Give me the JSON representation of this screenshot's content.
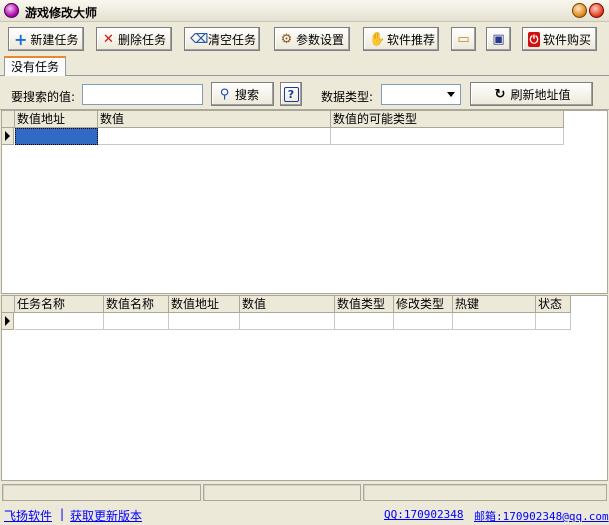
{
  "window": {
    "title": "游戏修改大师"
  },
  "toolbar": {
    "new_task": "新建任务",
    "delete_task": "删除任务",
    "clear_tasks": "清空任务",
    "settings": "参数设置",
    "recommend": "软件推荐",
    "buy": "软件购买"
  },
  "tabs": [
    {
      "label": "没有任务"
    }
  ],
  "search": {
    "label": "要搜索的值:",
    "value": "",
    "search_button": "搜索",
    "help_button": "?",
    "type_label": "数据类型:",
    "type_selected": "",
    "refresh_button": "刷新地址值"
  },
  "results_table": {
    "columns": [
      "数值地址",
      "数值",
      "数值的可能类型"
    ],
    "rows": [
      [
        "",
        "",
        ""
      ]
    ]
  },
  "tasks_table": {
    "columns": [
      "任务名称",
      "数值名称",
      "数值地址",
      "数值",
      "数值类型",
      "修改类型",
      "热键",
      "状态"
    ],
    "rows": [
      [
        "",
        "",
        "",
        "",
        "",
        "",
        "",
        ""
      ]
    ]
  },
  "footer": {
    "company": "飞扬软件",
    "separator": "|",
    "update": "获取更新版本",
    "qq": "QQ:170902348",
    "email": "邮箱:170902348@qq.com"
  },
  "colors": {
    "selection": "#316ac5",
    "tab_accent": "#e68b2c",
    "link": "#0000ff"
  }
}
